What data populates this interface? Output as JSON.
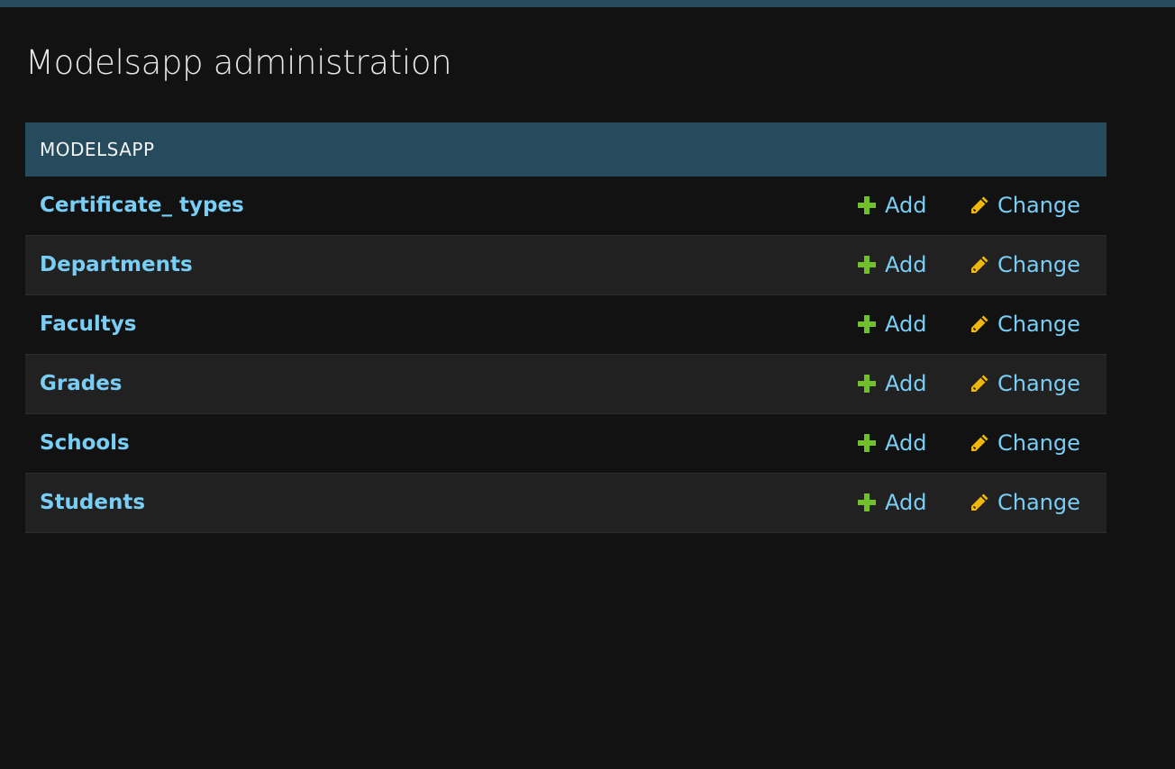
{
  "page": {
    "title": "Modelsapp administration"
  },
  "module": {
    "caption": "MODELSAPP",
    "add_label": "Add",
    "change_label": "Change",
    "models": [
      {
        "name": "Certificate_ types"
      },
      {
        "name": "Departments"
      },
      {
        "name": "Facultys"
      },
      {
        "name": "Grades"
      },
      {
        "name": "Schools"
      },
      {
        "name": "Students"
      }
    ]
  },
  "colors": {
    "header_bar": "#264b5d",
    "background": "#121212",
    "link": "#79cef5",
    "add_icon": "#70bf2b",
    "change_icon": "#efb80b"
  },
  "icons": {
    "add": "plus-icon",
    "change": "pencil-icon"
  }
}
